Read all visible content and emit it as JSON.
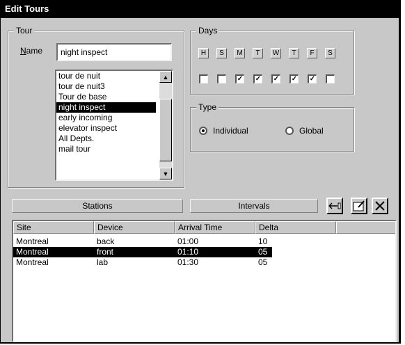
{
  "window": {
    "title": "Edit Tours"
  },
  "tour_group": {
    "title": "Tour",
    "name_label": "Name",
    "name_value": "night inspect",
    "tours": [
      "tour de nuit",
      "tour de nuit3",
      "Tour de base",
      "night inspect",
      "early incoming",
      "elevator inspect",
      "All Depts.",
      "mail tour"
    ],
    "selected_index": 3
  },
  "days_group": {
    "title": "Days",
    "day_letters": [
      "H",
      "S",
      "M",
      "T",
      "W",
      "T",
      "F",
      "S"
    ],
    "checked": [
      false,
      false,
      true,
      true,
      true,
      true,
      true,
      false
    ]
  },
  "type_group": {
    "title": "Type",
    "options": [
      "Individual",
      "Global"
    ],
    "selected": "Individual"
  },
  "section_headers": {
    "stations": "Stations",
    "intervals": "Intervals"
  },
  "table": {
    "columns": [
      "Site",
      "Device",
      "Arrival Time",
      "Delta"
    ],
    "rows": [
      {
        "site": "Montreal",
        "device": "back",
        "arrival": "01:00",
        "delta": "10"
      },
      {
        "site": "Montreal",
        "device": "front",
        "arrival": "01:10",
        "delta": "05"
      },
      {
        "site": "Montreal",
        "device": "lab",
        "arrival": "01:30",
        "delta": "05"
      }
    ],
    "selected_row": 1
  }
}
